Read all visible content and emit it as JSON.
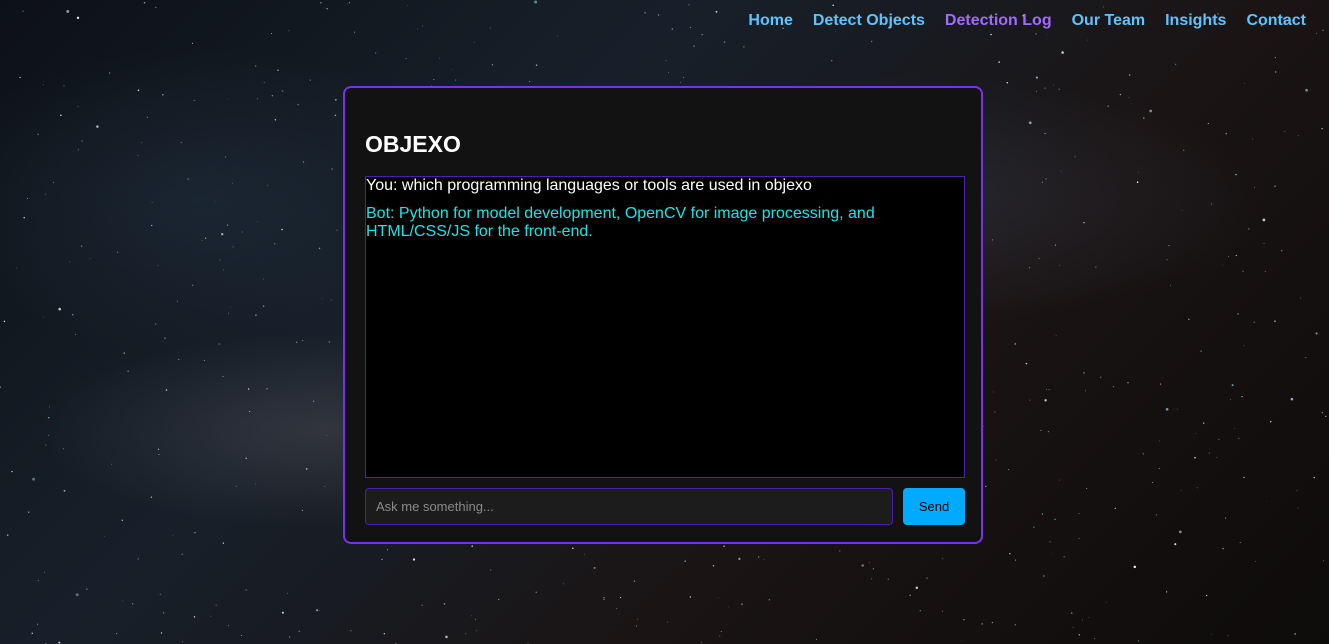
{
  "nav": {
    "items": [
      {
        "label": "Home",
        "active": false
      },
      {
        "label": "Detect Objects",
        "active": false
      },
      {
        "label": "Detection Log",
        "active": true
      },
      {
        "label": "Our Team",
        "active": false
      },
      {
        "label": "Insights",
        "active": false
      },
      {
        "label": "Contact",
        "active": false
      }
    ]
  },
  "chat": {
    "title": "OBJEXO",
    "messages": [
      {
        "sender": "user",
        "text": "You: which programming languages or tools are used in objexo"
      },
      {
        "sender": "bot",
        "text": "Bot: Python for model development, OpenCV for image processing, and HTML/CSS/JS for the front-end."
      }
    ],
    "input_placeholder": "Ask me something...",
    "input_value": "",
    "send_label": "Send"
  },
  "colors": {
    "nav_link": "#5ec3ff",
    "nav_active": "#a06bff",
    "card_border": "#7b2ff0",
    "bot_text": "#17e6e6",
    "send_button": "#00aaff"
  }
}
